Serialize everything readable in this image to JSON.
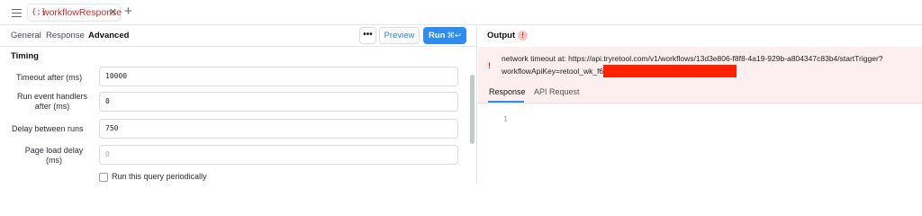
{
  "tabbar": {
    "query_tab": {
      "icon": "{;}",
      "name": "workflowResponse",
      "close": "✕"
    },
    "add_tab": "+"
  },
  "editor": {
    "subtabs": [
      "General",
      "Response",
      "Advanced"
    ],
    "active_subtab": "Advanced",
    "more": "•••",
    "preview_label": "Preview",
    "run_label": "Run",
    "run_shortcut": "⌘↩",
    "section_title": "Timing",
    "fields": {
      "timeout": {
        "label": "Timeout after (ms)",
        "value": "10000"
      },
      "run_event": {
        "label_line1": "Run event handlers",
        "label_line2": "after (ms)",
        "value": "0"
      },
      "delay": {
        "label": "Delay between runs",
        "value": "750"
      },
      "page_load": {
        "label_line1": "Page load delay",
        "label_line2": "(ms)",
        "placeholder": "0"
      }
    },
    "checkbox_label": "Run this query periodically"
  },
  "output": {
    "title": "Output",
    "alert": "!",
    "error_icon": "!",
    "error_line1": "network timeout at: https://api.tryretool.com/v1/workflows/13d3e806-f8f8-4a19-929b-a804347c83b4/startTrigger?",
    "error_line2": "workflowApiKey=retool_wk_f6",
    "tabs": [
      "Response",
      "API Request"
    ],
    "active_tab": "Response",
    "line_number": "1"
  },
  "colors": {
    "accent": "#2d8ef0",
    "error_red": "#d12a2a",
    "error_bg": "#fdeef0",
    "redaction": "#ff2200"
  }
}
